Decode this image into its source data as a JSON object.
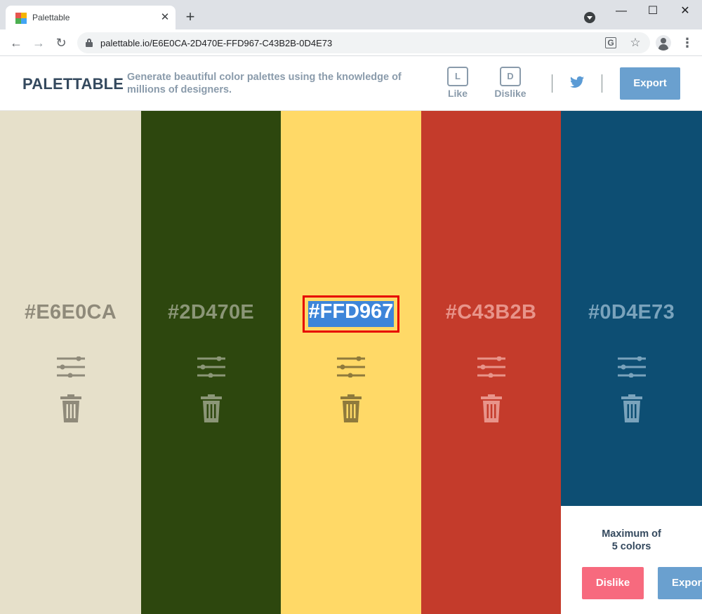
{
  "browser": {
    "tab_title": "Palettable",
    "url": "palettable.io/E6E0CA-2D470E-FFD967-C43B2B-0D4E73",
    "new_tab": "+",
    "tab_close": "✕",
    "minimize": "—",
    "maximize": "☐",
    "close": "✕",
    "back": "←",
    "forward": "→",
    "reload": "↻",
    "star": "☆",
    "translate": "G",
    "menu": "⋮"
  },
  "header": {
    "logo": "PALETTABLE",
    "tagline": "Generate beautiful color palettes using the knowledge of millions of designers.",
    "like_key": "L",
    "like_label": "Like",
    "dislike_key": "D",
    "dislike_label": "Dislike",
    "export_label": "Export",
    "twitter_icon": "twitter-icon"
  },
  "palette": {
    "swatches": [
      {
        "hex": "#E6E0CA",
        "bg": "#e6e0ca",
        "fg": "#8f8a7a"
      },
      {
        "hex": "#2D470E",
        "bg": "#2d470e",
        "fg": "#8b9677"
      },
      {
        "hex": "#FFD967",
        "bg": "#ffd967",
        "fg": "#ffffff",
        "selected": true
      },
      {
        "hex": "#C43B2B",
        "bg": "#c43b2b",
        "fg": "#e8948a"
      },
      {
        "hex": "#0D4E73",
        "bg": "#0d4e73",
        "fg": "#7aa3bc"
      }
    ],
    "icon_colors": [
      "#8f8a7a",
      "#8b9677",
      "#8f7a3c",
      "#e8948a",
      "#7aa3bc"
    ],
    "limit_line1": "Maximum of",
    "limit_line2": "5 colors",
    "dislike_label": "Dislike",
    "export_label": "Export"
  },
  "colors": {
    "accent": "#6aa0cf",
    "danger": "#f76a7e",
    "text_dark": "#34495e",
    "text_muted": "#8a9bab",
    "selection": "#3d85d9",
    "highlight_border": "#e60000"
  }
}
